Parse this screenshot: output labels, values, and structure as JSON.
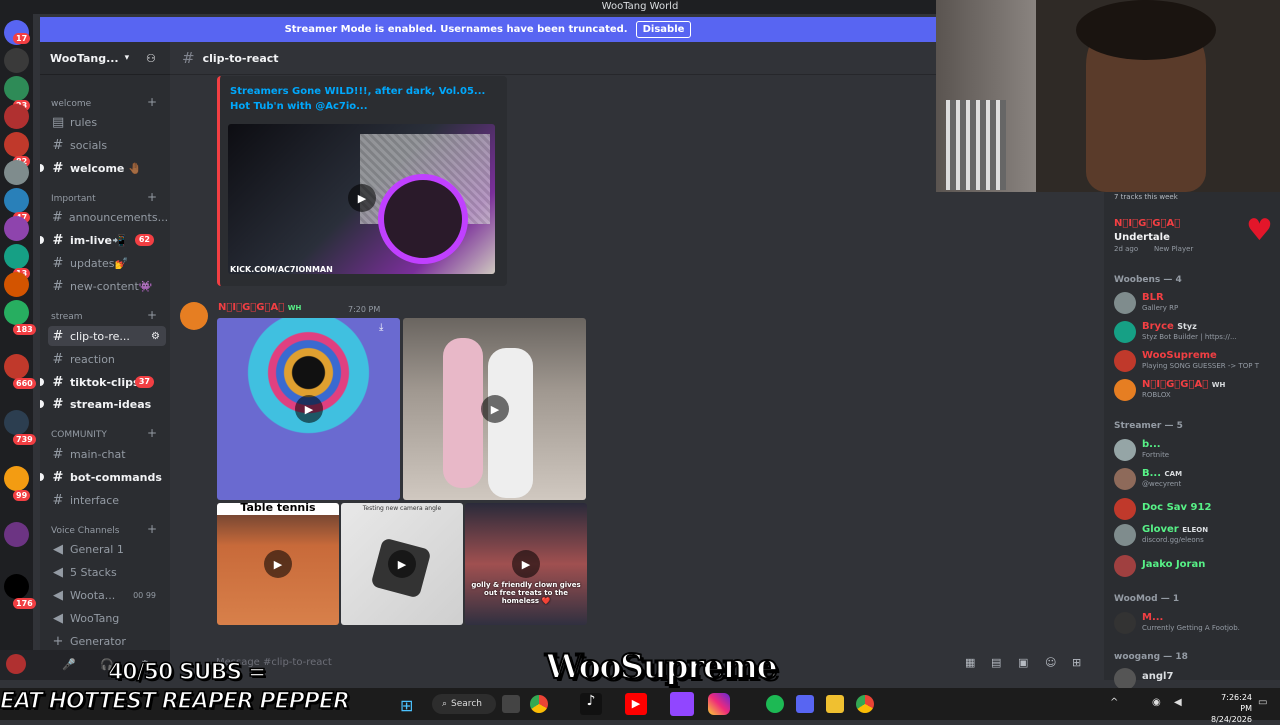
{
  "window": {
    "title": "WooTang World"
  },
  "banner": {
    "text": "Streamer Mode is enabled. Usernames have been truncated.",
    "button": "Disable"
  },
  "server": {
    "name": "WooTang..."
  },
  "server_badges": [
    "17",
    "23",
    "82",
    "47",
    "13",
    "12",
    "20",
    "10",
    "183",
    "660",
    "739",
    "99",
    "176"
  ],
  "categories": {
    "welcome": "welcome",
    "important": "Important",
    "stream": "stream",
    "community": "COMMUNITY",
    "voice": "Voice Channels"
  },
  "channels": {
    "rules": "rules",
    "socials": "socials",
    "welcome": "welcome 🤚🏾",
    "announcements": "announcements...",
    "im_live": "im-live📲",
    "im_live_badge": "62",
    "updates": "updates💅",
    "new_content": "new-content👾",
    "clip_to_react": "clip-to-re...",
    "reaction": "reaction",
    "tiktok_clips": "tiktok-clips",
    "tiktok_badge": "37",
    "stream_ideas": "stream-ideas",
    "main_chat": "main-chat",
    "bot_commands": "bot-commands",
    "interface": "interface"
  },
  "voice": {
    "general": "General 1",
    "stacks": "5 Stacks",
    "wootang_live": "Wootа...",
    "live_counts": "00 99",
    "wootang": "WooTang",
    "generator": "Generator"
  },
  "chat": {
    "channel": "clip-to-react",
    "input_placeholder": "Message #clip-to-react"
  },
  "embed": {
    "title": "Streamers Gone WILD!!!, after dark, Vol.05... Hot Tub'n with @Ac7io...",
    "watermark": "KICK.COM/AC7IONMAN"
  },
  "message": {
    "author": "N⃝I⃝G⃝G⃝A⃝",
    "badge": "WH",
    "time": "7:20 PM",
    "clip_labels": [
      "Table tennis",
      "Testing new camera angle",
      "golly & friendly clown gives out free treats to the homeless ❤️"
    ]
  },
  "members": {
    "top_tracks": "7 tracks this week",
    "top_user": {
      "name": "N⃝I⃝G⃝G⃝A⃝",
      "activity": "Undertale",
      "sub": "2d ago",
      "role": "New Player"
    },
    "groups": [
      {
        "label": "Woobens — 4",
        "items": [
          {
            "name": "BLR",
            "activity": "Gallery RP",
            "color": "#f23f43"
          },
          {
            "name": "Bryce",
            "tag": "Styz",
            "activity": "Styz Bot Builder | https://...",
            "color": "#f23f43"
          },
          {
            "name": "WooSupreme",
            "activity": "Playing SONG GUESSER -> TOP T",
            "color": "#f23f43"
          },
          {
            "name": "N⃝I⃝G⃝G⃝A⃝",
            "tag": "WH",
            "activity": "ROBLOX",
            "color": "#f23f43"
          }
        ]
      },
      {
        "label": "Streamer — 5",
        "items": [
          {
            "name": "b...",
            "activity": "Fortnite",
            "color": "#57f287"
          },
          {
            "name": "B...",
            "tag": "CAM",
            "activity": "@wecyrent",
            "color": "#57f287"
          },
          {
            "name": "Doc Sav 912",
            "activity": "",
            "color": "#57f287"
          },
          {
            "name": "Glover",
            "tag": "ELEON",
            "activity": "discord.gg/eleons",
            "color": "#57f287"
          },
          {
            "name": "Jaako Joran",
            "activity": "",
            "color": "#57f287"
          }
        ]
      },
      {
        "label": "WooMod — 1",
        "items": [
          {
            "name": "M...",
            "activity": "Currently Getting A Footjob.",
            "color": "#f23f43"
          }
        ]
      },
      {
        "label": "woogang — 18",
        "items": [
          {
            "name": "angl7",
            "activity": "",
            "color": "#dbdee1"
          }
        ]
      }
    ]
  },
  "overlay": {
    "subs": "40/50 SUBS =",
    "goal": "EAT HOTTEST REAPER PEPPER",
    "brand": "WooSupreme"
  },
  "taskbar": {
    "search": "Search",
    "time": "7:26:24 PM",
    "date": "8/24/2026"
  }
}
